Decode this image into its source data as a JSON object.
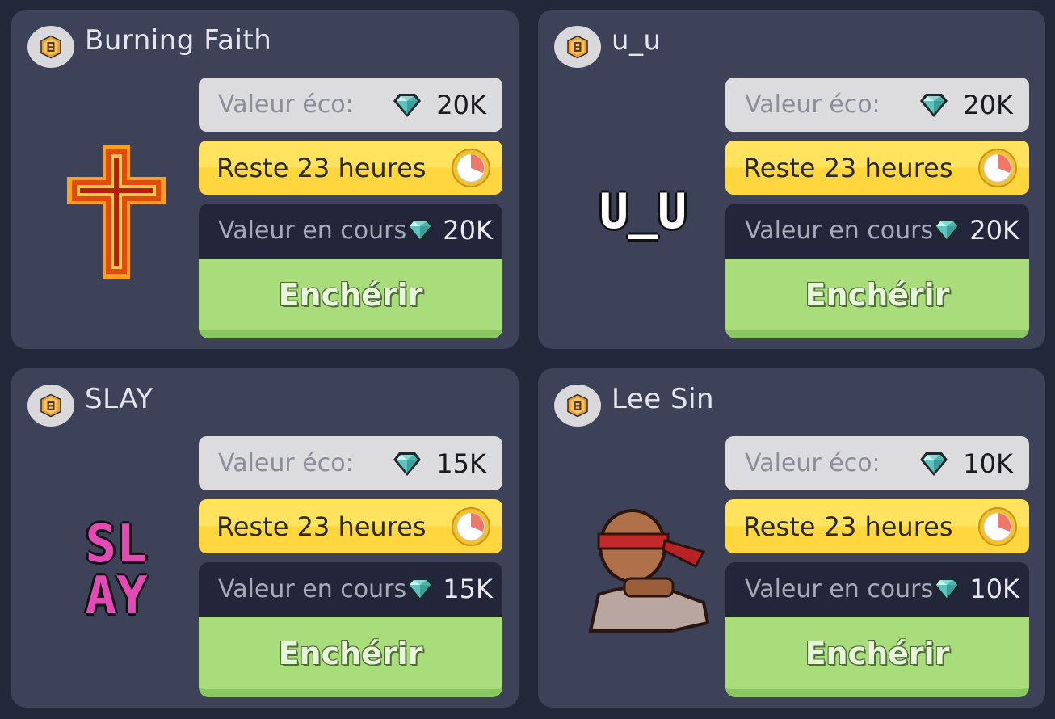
{
  "cards": [
    {
      "name": "Burning Faith",
      "eco_label": "Valeur éco:",
      "eco_value": "20K",
      "time_label": "Reste 23 heures",
      "current_label": "Valeur en cours",
      "current_value": "20K",
      "bid_label": "Enchérir",
      "art": "burning-cross"
    },
    {
      "name": "u_u",
      "eco_label": "Valeur éco:",
      "eco_value": "20K",
      "time_label": "Reste 23 heures",
      "current_label": "Valeur en cours",
      "current_value": "20K",
      "bid_label": "Enchérir",
      "art": "u_u"
    },
    {
      "name": "SLAY",
      "eco_label": "Valeur éco:",
      "eco_value": "15K",
      "time_label": "Reste 23 heures",
      "current_label": "Valeur en cours",
      "current_value": "15K",
      "bid_label": "Enchérir",
      "art": "slay"
    },
    {
      "name": "Lee Sin",
      "eco_label": "Valeur éco:",
      "eco_value": "10K",
      "time_label": "Reste 23 heures",
      "current_label": "Valeur en cours",
      "current_value": "10K",
      "bid_label": "Enchérir",
      "art": "lee-sin"
    }
  ],
  "art_text": {
    "u_u": "U_U",
    "slay_top": "SL",
    "slay_bottom": "AY"
  },
  "colors": {
    "card_bg": "#3d4258",
    "page_bg": "#23273a",
    "eco_bg": "#dcdcdf",
    "time_bg": "#ffd63d",
    "current_bg": "#23263a",
    "bid_bg": "#a9dd7c"
  }
}
